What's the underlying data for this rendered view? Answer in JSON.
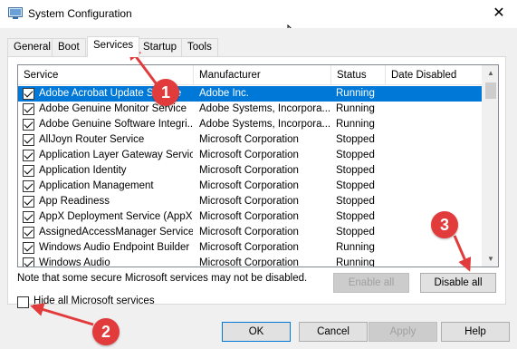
{
  "window": {
    "title": "System Configuration",
    "close_glyph": "✕"
  },
  "tabs": [
    {
      "label": "General"
    },
    {
      "label": "Boot"
    },
    {
      "label": "Services",
      "active": true
    },
    {
      "label": "Startup"
    },
    {
      "label": "Tools"
    }
  ],
  "services_list": {
    "columns": [
      "Service",
      "Manufacturer",
      "Status",
      "Date Disabled"
    ],
    "rows": [
      {
        "service": "Adobe Acrobat Update Service",
        "manufacturer": "Adobe Inc.",
        "status": "Running",
        "date_disabled": "",
        "checked": true,
        "selected": true
      },
      {
        "service": "Adobe Genuine Monitor Service",
        "manufacturer": "Adobe Systems, Incorpora...",
        "status": "Running",
        "date_disabled": "",
        "checked": true
      },
      {
        "service": "Adobe Genuine Software Integri...",
        "manufacturer": "Adobe Systems, Incorpora...",
        "status": "Running",
        "date_disabled": "",
        "checked": true
      },
      {
        "service": "AllJoyn Router Service",
        "manufacturer": "Microsoft Corporation",
        "status": "Stopped",
        "date_disabled": "",
        "checked": true
      },
      {
        "service": "Application Layer Gateway Service",
        "manufacturer": "Microsoft Corporation",
        "status": "Stopped",
        "date_disabled": "",
        "checked": true
      },
      {
        "service": "Application Identity",
        "manufacturer": "Microsoft Corporation",
        "status": "Stopped",
        "date_disabled": "",
        "checked": true
      },
      {
        "service": "Application Management",
        "manufacturer": "Microsoft Corporation",
        "status": "Stopped",
        "date_disabled": "",
        "checked": true
      },
      {
        "service": "App Readiness",
        "manufacturer": "Microsoft Corporation",
        "status": "Stopped",
        "date_disabled": "",
        "checked": true
      },
      {
        "service": "AppX Deployment Service (AppX...",
        "manufacturer": "Microsoft Corporation",
        "status": "Stopped",
        "date_disabled": "",
        "checked": true
      },
      {
        "service": "AssignedAccessManager Service",
        "manufacturer": "Microsoft Corporation",
        "status": "Stopped",
        "date_disabled": "",
        "checked": true
      },
      {
        "service": "Windows Audio Endpoint Builder",
        "manufacturer": "Microsoft Corporation",
        "status": "Running",
        "date_disabled": "",
        "checked": true
      },
      {
        "service": "Windows Audio",
        "manufacturer": "Microsoft Corporation",
        "status": "Running",
        "date_disabled": "",
        "checked": true
      }
    ],
    "scroll_up_glyph": "▲",
    "scroll_down_glyph": "▼"
  },
  "note": "Note that some secure Microsoft services may not be disabled.",
  "buttons": {
    "enable_all": "Enable all",
    "disable_all": "Disable all",
    "ok": "OK",
    "cancel": "Cancel",
    "apply": "Apply",
    "help": "Help"
  },
  "hide_ms_services": {
    "label": "Hide all Microsoft services",
    "checked": false
  },
  "callouts": [
    "1",
    "2",
    "3"
  ],
  "colors": {
    "selection": "#0078d7",
    "callout": "#e23b3b",
    "dialog_bg": "#f0f0f0"
  }
}
